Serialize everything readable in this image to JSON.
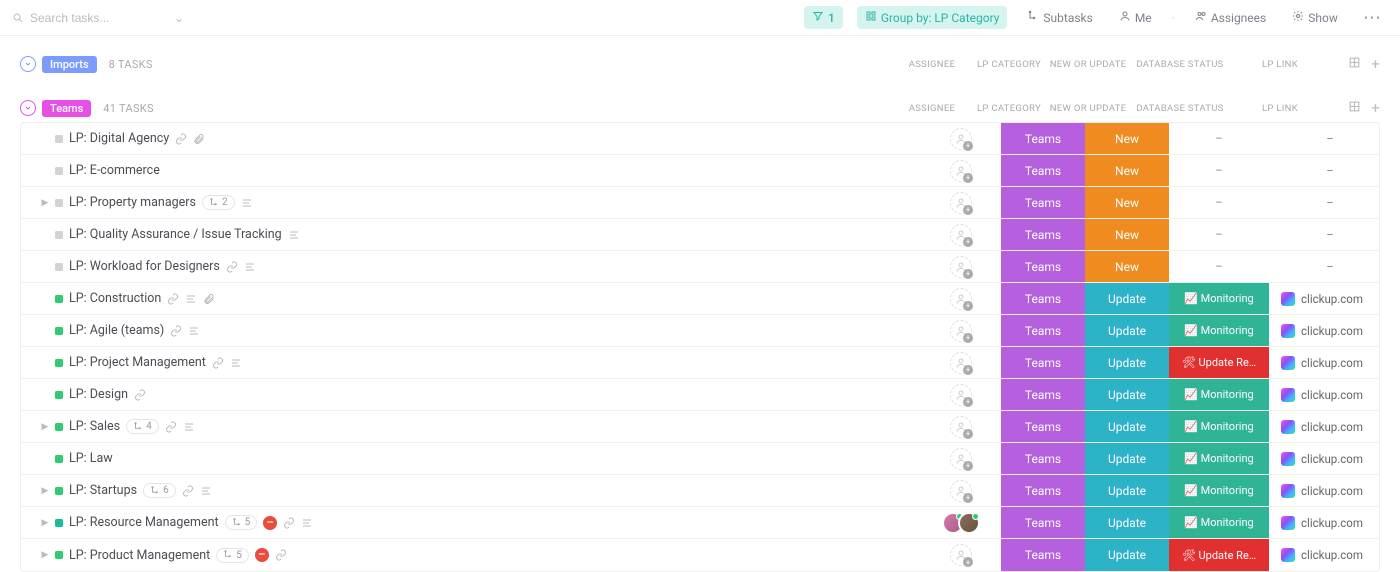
{
  "search": {
    "placeholder": "Search tasks..."
  },
  "toolbar": {
    "filter_count": "1",
    "group_label": "Group by: LP Category",
    "subtasks": "Subtasks",
    "me": "Me",
    "assignees": "Assignees",
    "show": "Show"
  },
  "columns": {
    "assignee": "ASSIGNEE",
    "category": "LP CATEGORY",
    "newupdate": "NEW OR UPDATE",
    "dbs": "DATABASE STATUS",
    "link": "LP LINK"
  },
  "groups": [
    {
      "name": "Imports",
      "count": "8 TASKS",
      "badge_class": "imports",
      "toggle_color": "#7b9cff"
    },
    {
      "name": "Teams",
      "count": "41 TASKS",
      "badge_class": "teams",
      "toggle_color": "#e750e7"
    }
  ],
  "rows": [
    {
      "name": "LP: Digital Agency",
      "status": "grey",
      "expand": false,
      "sub": null,
      "link_icon": true,
      "doc_icon": false,
      "attach_icon": true,
      "blocked": false,
      "avatars": 0,
      "cat": "Teams",
      "newup": "New",
      "dbs": "-",
      "link": "-"
    },
    {
      "name": "LP: E-commerce",
      "status": "grey",
      "expand": false,
      "sub": null,
      "link_icon": false,
      "doc_icon": false,
      "attach_icon": false,
      "blocked": false,
      "avatars": 0,
      "cat": "Teams",
      "newup": "New",
      "dbs": "-",
      "link": "-"
    },
    {
      "name": "LP: Property managers",
      "status": "grey",
      "expand": true,
      "sub": "2",
      "link_icon": false,
      "doc_icon": true,
      "attach_icon": false,
      "blocked": false,
      "avatars": 0,
      "cat": "Teams",
      "newup": "New",
      "dbs": "-",
      "link": "-"
    },
    {
      "name": "LP: Quality Assurance / Issue Tracking",
      "status": "grey",
      "expand": false,
      "sub": null,
      "link_icon": false,
      "doc_icon": true,
      "attach_icon": false,
      "blocked": false,
      "avatars": 0,
      "cat": "Teams",
      "newup": "New",
      "dbs": "-",
      "link": "-"
    },
    {
      "name": "LP: Workload for Designers",
      "status": "grey",
      "expand": false,
      "sub": null,
      "link_icon": true,
      "doc_icon": true,
      "attach_icon": false,
      "blocked": false,
      "avatars": 0,
      "cat": "Teams",
      "newup": "New",
      "dbs": "-",
      "link": "-"
    },
    {
      "name": "LP: Construction",
      "status": "green",
      "expand": false,
      "sub": null,
      "link_icon": true,
      "doc_icon": true,
      "attach_icon": true,
      "blocked": false,
      "avatars": 0,
      "cat": "Teams",
      "newup": "Update",
      "dbs": "📈 Monitoring",
      "link": "clickup.com"
    },
    {
      "name": "LP: Agile (teams)",
      "status": "green",
      "expand": false,
      "sub": null,
      "link_icon": true,
      "doc_icon": true,
      "attach_icon": false,
      "blocked": false,
      "avatars": 0,
      "cat": "Teams",
      "newup": "Update",
      "dbs": "📈 Monitoring",
      "link": "clickup.com"
    },
    {
      "name": "LP: Project Management",
      "status": "green",
      "expand": false,
      "sub": null,
      "link_icon": true,
      "doc_icon": true,
      "attach_icon": false,
      "blocked": false,
      "avatars": 0,
      "cat": "Teams",
      "newup": "Update",
      "dbs": "🛠 Update Re…",
      "link": "clickup.com"
    },
    {
      "name": "LP: Design",
      "status": "green",
      "expand": false,
      "sub": null,
      "link_icon": true,
      "doc_icon": false,
      "attach_icon": false,
      "blocked": false,
      "avatars": 0,
      "cat": "Teams",
      "newup": "Update",
      "dbs": "📈 Monitoring",
      "link": "clickup.com"
    },
    {
      "name": "LP: Sales",
      "status": "green",
      "expand": true,
      "sub": "4",
      "link_icon": true,
      "doc_icon": true,
      "attach_icon": false,
      "blocked": false,
      "avatars": 0,
      "cat": "Teams",
      "newup": "Update",
      "dbs": "📈 Monitoring",
      "link": "clickup.com"
    },
    {
      "name": "LP: Law",
      "status": "green",
      "expand": false,
      "sub": null,
      "link_icon": false,
      "doc_icon": false,
      "attach_icon": false,
      "blocked": false,
      "avatars": 0,
      "cat": "Teams",
      "newup": "Update",
      "dbs": "📈 Monitoring",
      "link": "clickup.com"
    },
    {
      "name": "LP: Startups",
      "status": "green",
      "expand": true,
      "sub": "6",
      "link_icon": true,
      "doc_icon": true,
      "attach_icon": false,
      "blocked": false,
      "avatars": 0,
      "cat": "Teams",
      "newup": "Update",
      "dbs": "📈 Monitoring",
      "link": "clickup.com"
    },
    {
      "name": "LP: Resource Management",
      "status": "blue",
      "expand": true,
      "sub": "5",
      "link_icon": true,
      "doc_icon": true,
      "attach_icon": false,
      "blocked": true,
      "avatars": 2,
      "cat": "Teams",
      "newup": "Update",
      "dbs": "📈 Monitoring",
      "link": "clickup.com"
    },
    {
      "name": "LP: Product Management",
      "status": "green",
      "expand": true,
      "sub": "5",
      "link_icon": true,
      "doc_icon": false,
      "attach_icon": false,
      "blocked": true,
      "avatars": 0,
      "cat": "Teams",
      "newup": "Update",
      "dbs": "🛠 Update Re…",
      "link": "clickup.com"
    }
  ]
}
